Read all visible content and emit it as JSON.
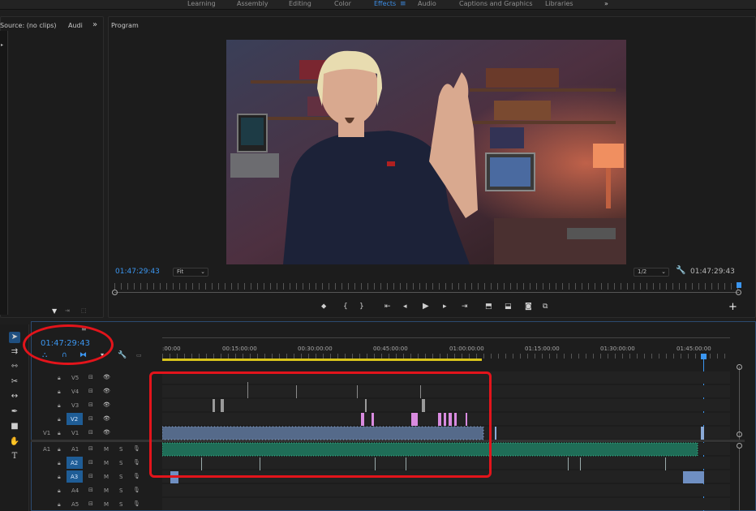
{
  "workspace_tabs": [
    "Learning",
    "Assembly",
    "Editing",
    "Color",
    "Effects",
    "Audio",
    "Captions and Graphics",
    "Libraries"
  ],
  "workspace_active": "Effects",
  "workspace_more": "»",
  "source_panel": {
    "title": "Source: (no clips)",
    "audio_tab": "Audi",
    "more": "»"
  },
  "program_panel": {
    "title": "Program",
    "timecode_left": "01:47:29:43",
    "fit_label": "Fit",
    "resolution_label": "1/2",
    "timecode_right": "01:47:29:43"
  },
  "transport_icons": [
    "marker-icon",
    "in-point-icon",
    "out-point-icon",
    "go-to-in-icon",
    "step-back-icon",
    "play-icon",
    "step-forward-icon",
    "go-to-out-icon",
    "lift-icon",
    "extract-icon",
    "export-frame-icon",
    "compare-icon"
  ],
  "add_button": "+",
  "timeline": {
    "timecode": "01:47:29:43",
    "ruler_labels": [
      ":00:00",
      "00:15:00:00",
      "00:30:00:00",
      "00:45:00:00",
      "01:00:00:00",
      "01:15:00:00",
      "01:30:00:00",
      "01:45:00:00"
    ],
    "video_tracks": [
      "V5",
      "V4",
      "V3",
      "V2",
      "V1"
    ],
    "audio_tracks": [
      "A1",
      "A2",
      "A3",
      "A4",
      "A5"
    ],
    "source_patch_v": "V1",
    "source_patch_a": "A1",
    "mute_label": "M",
    "solo_label": "S"
  },
  "colors": {
    "accent": "#3b96f0",
    "annotation": "#e3141b",
    "video_clip": "#8aa9d6",
    "audio_clip": "#2fae86",
    "pink_clip": "#d98be0"
  }
}
